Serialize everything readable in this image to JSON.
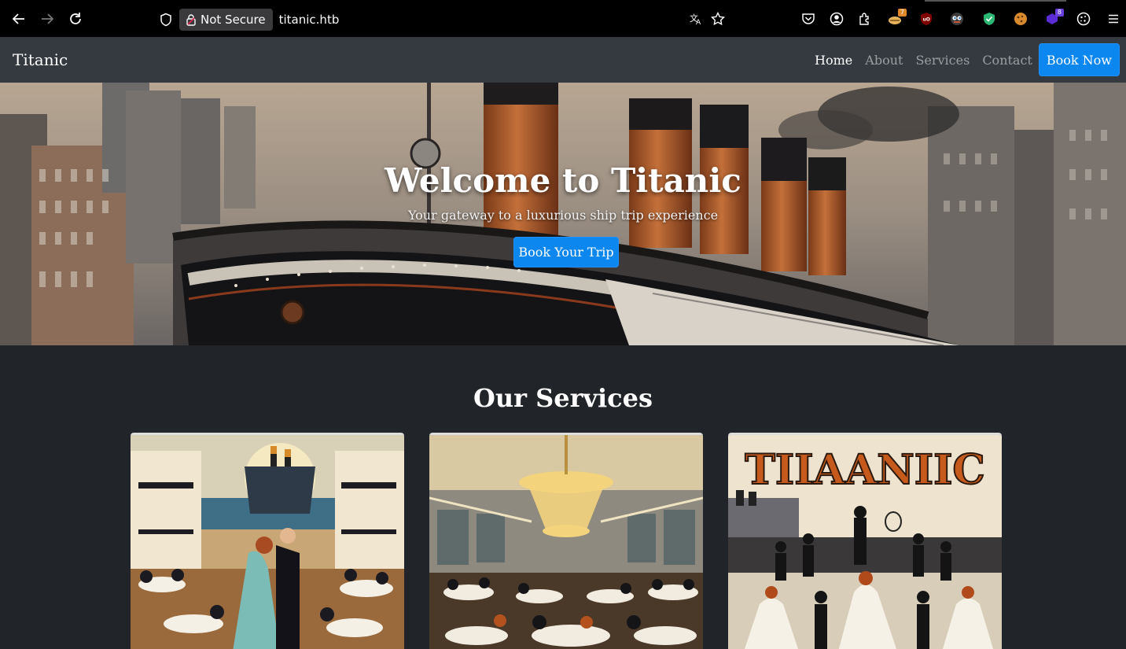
{
  "browser": {
    "not_secure_label": "Not Secure",
    "url": "titanic.htb",
    "icons": [
      "back-arrow-icon",
      "forward-arrow-icon",
      "reload-icon",
      "shield-icon",
      "lock-icon",
      "translate-icon",
      "star-icon",
      "pocket-icon",
      "account-icon",
      "extensions-icon",
      "extension-1-icon",
      "ublock-icon",
      "extension-eyes-icon",
      "extension-shield-icon",
      "extension-cookie-icon",
      "extension-purple-icon",
      "cookie-icon",
      "menu-icon"
    ],
    "badges": {
      "extension_1": "7",
      "extension_purple": "8"
    }
  },
  "navbar": {
    "brand": "Titanic",
    "links": [
      {
        "label": "Home",
        "active": true
      },
      {
        "label": "About",
        "active": false
      },
      {
        "label": "Services",
        "active": false
      },
      {
        "label": "Contact",
        "active": false
      }
    ],
    "cta": "Book Now"
  },
  "hero": {
    "title": "Welcome to Titanic",
    "subtitle": "Your gateway to a luxurious ship trip experience",
    "button": "Book Your Trip"
  },
  "services": {
    "heading": "Our Services",
    "cards": [
      {
        "image": "ballroom-dancing-painting"
      },
      {
        "image": "chandelier-dining-hall-painting"
      },
      {
        "image": "titanic-poster-painting",
        "poster_text": "TIIAANIIC"
      }
    ]
  },
  "colors": {
    "primary": "#0d87f0",
    "navbar": "#343a40",
    "page_bg": "#212529"
  }
}
